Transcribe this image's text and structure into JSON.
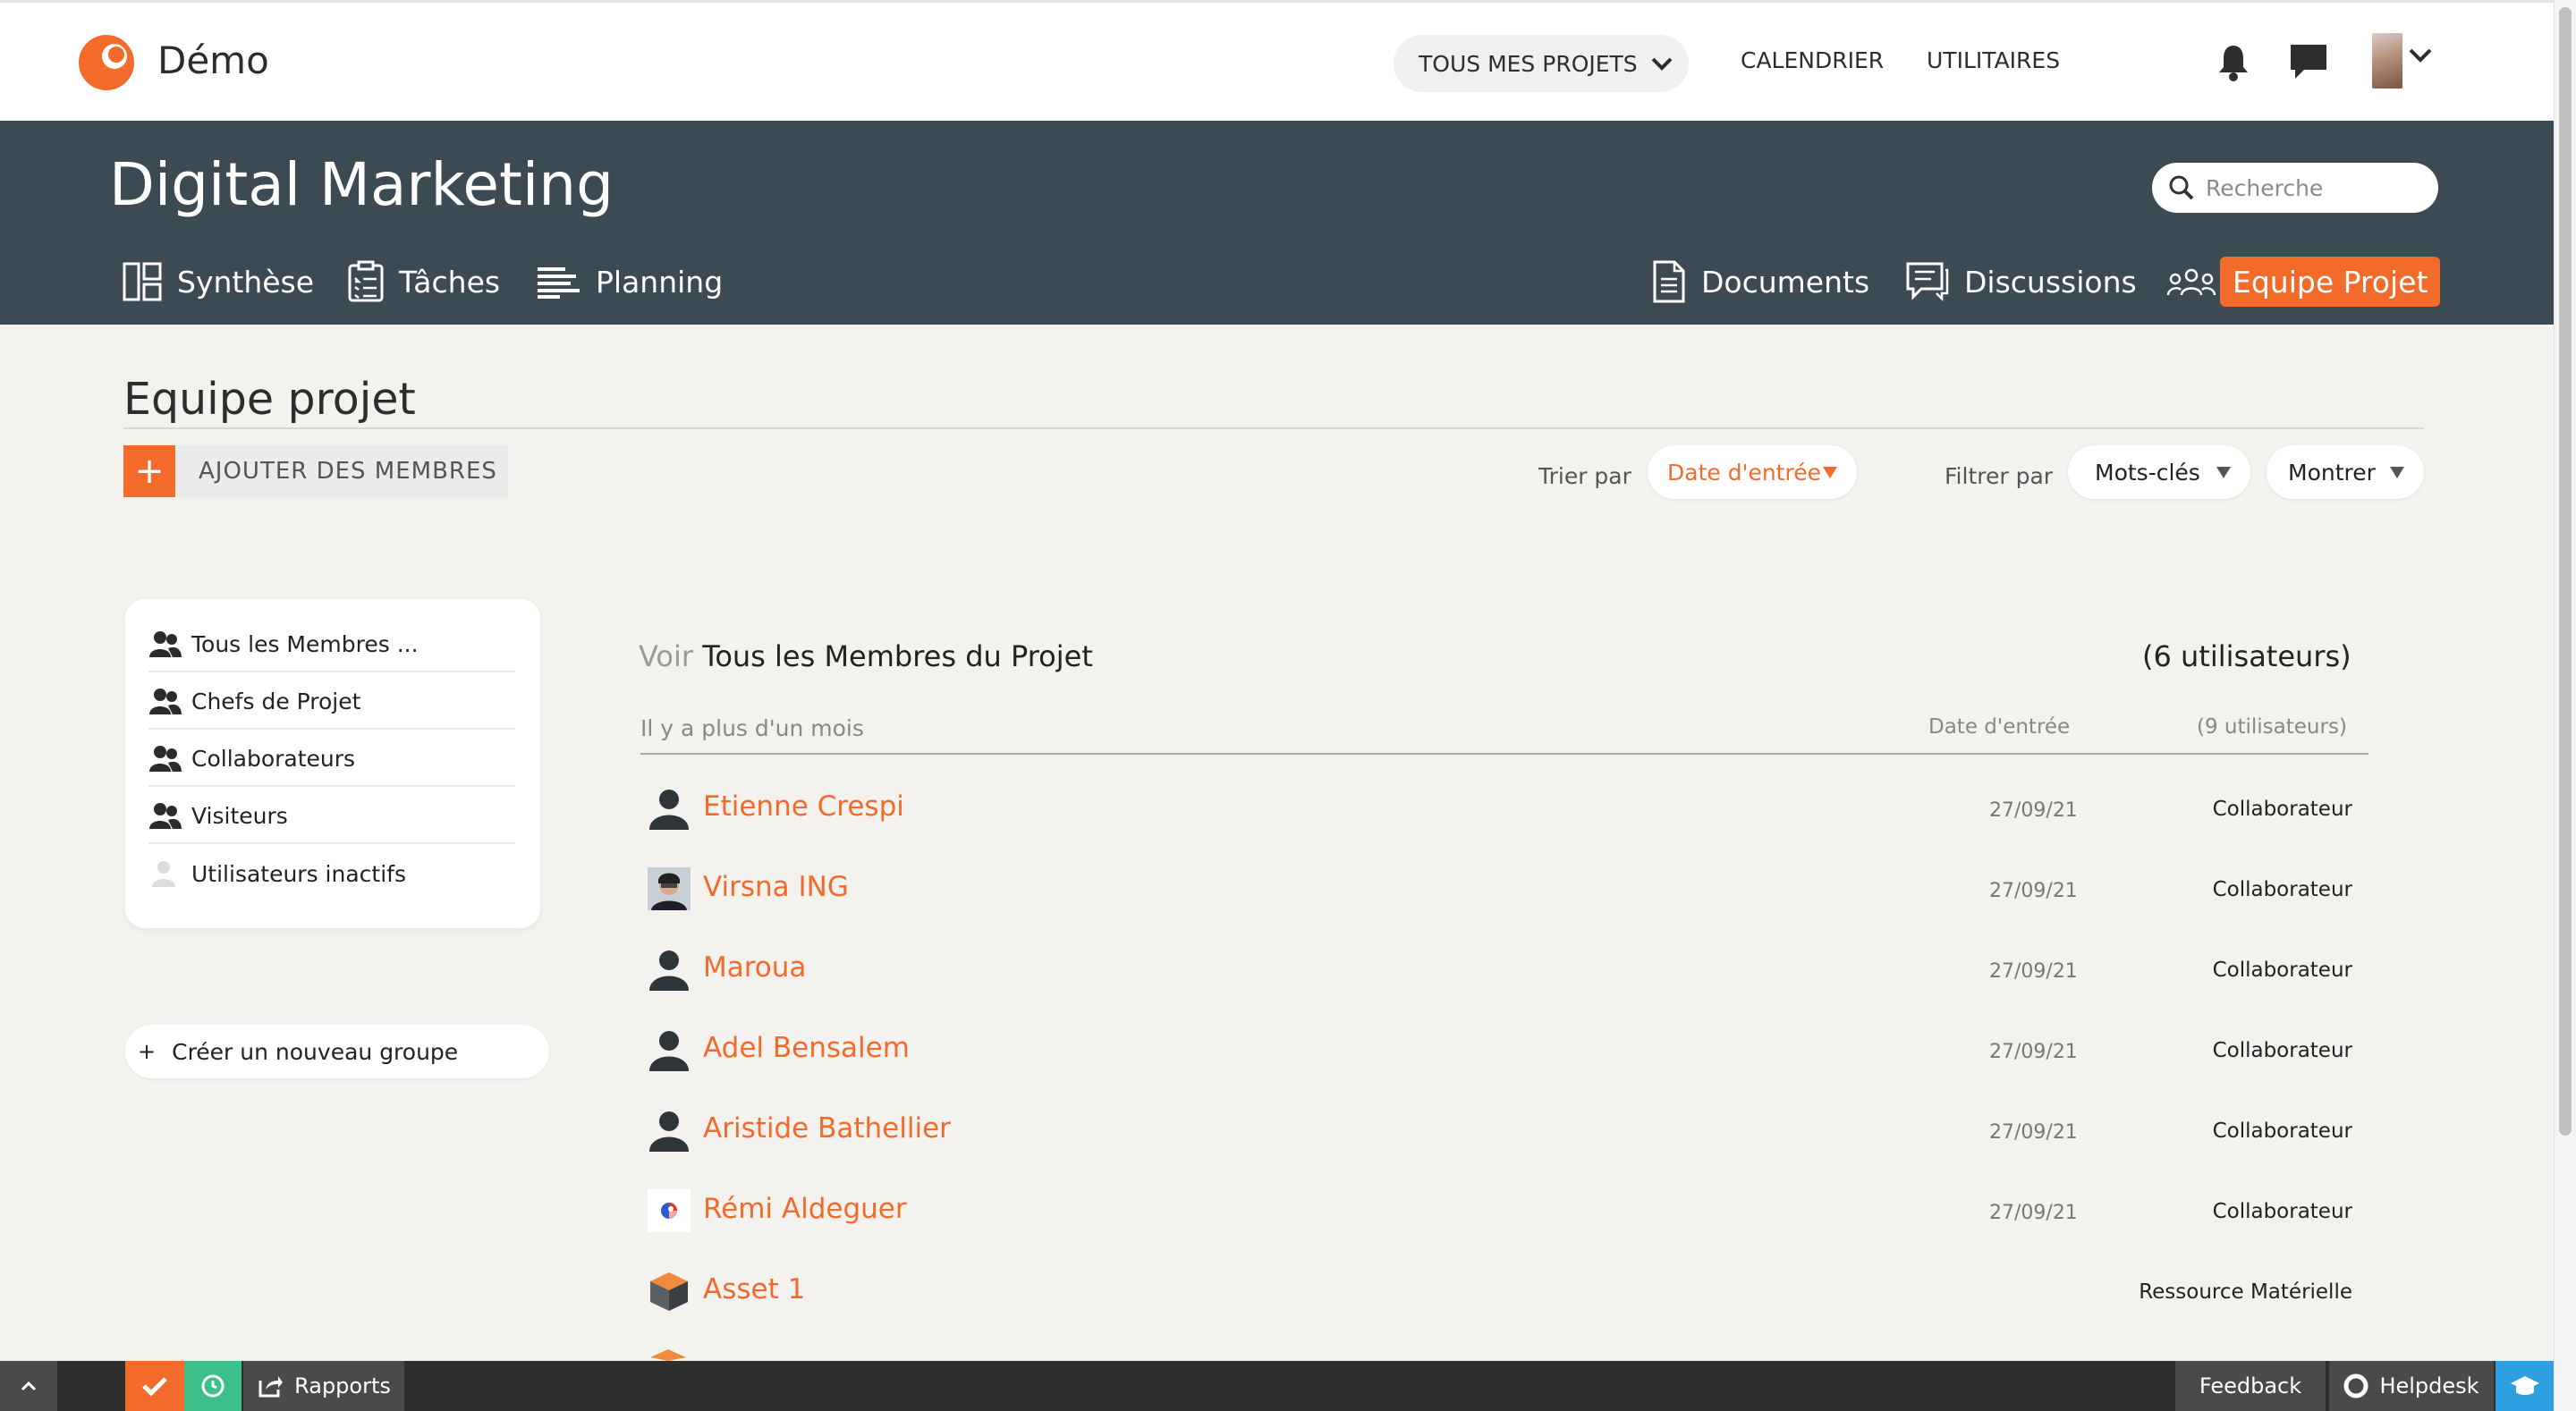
{
  "colors": {
    "accent": "#f26b2a",
    "header_band": "#3c4a53",
    "bottom_bar": "#2e2e2e"
  },
  "topbar": {
    "brand": "Démo",
    "projects_label": "TOUS MES PROJETS",
    "calendar_label": "CALENDRIER",
    "utilities_label": "UTILITAIRES",
    "icons": [
      "bell-icon",
      "chat-icon",
      "user-avatar",
      "chevron-down-icon"
    ]
  },
  "project": {
    "title": "Digital Marketing",
    "search_placeholder": "Recherche",
    "tabs": [
      {
        "label": "Synthèse",
        "icon": "layout-icon"
      },
      {
        "label": "Tâches",
        "icon": "clipboard-icon"
      },
      {
        "label": "Planning",
        "icon": "gantt-icon"
      },
      {
        "label": "Documents",
        "icon": "document-icon"
      },
      {
        "label": "Discussions",
        "icon": "discussion-icon"
      },
      {
        "label": "Equipe Projet",
        "icon": "team-icon",
        "active": true
      }
    ]
  },
  "content": {
    "title": "Equipe projet",
    "add_members": "AJOUTER DES MEMBRES",
    "sort_label": "Trier par",
    "sort_value": "Date d'entrée",
    "filter_label": "Filtrer par",
    "filter_keywords": "Mots-clés",
    "filter_show": "Montrer"
  },
  "sidebar": {
    "items": [
      {
        "label": "Tous les Membres ...",
        "icon": "group-icon"
      },
      {
        "label": "Chefs de Projet",
        "icon": "group-icon"
      },
      {
        "label": "Collaborateurs",
        "icon": "group-icon"
      },
      {
        "label": "Visiteurs",
        "icon": "group-icon"
      },
      {
        "label": "Utilisateurs inactifs",
        "icon": "inactive-user-icon"
      }
    ],
    "create_group": "Créer un nouveau groupe"
  },
  "members": {
    "voir": "Voir",
    "heading": "Tous les Membres du Projet",
    "count": "(6 utilisateurs)",
    "group_label": "Il y a plus d'un mois",
    "col_date": "Date d'entrée",
    "col_count": "(9 utilisateurs)",
    "rows": [
      {
        "name": "Etienne Crespi",
        "date": "27/09/21",
        "role": "Collaborateur",
        "avatar": "default-user-icon"
      },
      {
        "name": "Virsna ING",
        "date": "27/09/21",
        "role": "Collaborateur",
        "avatar": "photo"
      },
      {
        "name": "Maroua",
        "date": "27/09/21",
        "role": "Collaborateur",
        "avatar": "default-user-icon"
      },
      {
        "name": "Adel Bensalem",
        "date": "27/09/21",
        "role": "Collaborateur",
        "avatar": "default-user-icon"
      },
      {
        "name": "Aristide Bathellier",
        "date": "27/09/21",
        "role": "Collaborateur",
        "avatar": "default-user-icon"
      },
      {
        "name": "Rémi Aldeguer",
        "date": "27/09/21",
        "role": "Collaborateur",
        "avatar": "logo"
      },
      {
        "name": "Asset 1",
        "date": "",
        "role": "Ressource Matérielle",
        "avatar": "cube-icon"
      }
    ]
  },
  "bottombar": {
    "reports": "Rapports",
    "feedback": "Feedback",
    "helpdesk": "Helpdesk"
  }
}
